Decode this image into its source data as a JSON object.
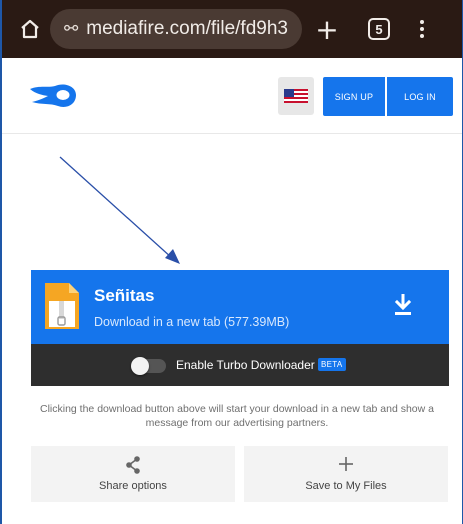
{
  "browser": {
    "url_text": "mediafire.com/file/fd9h3",
    "tab_count": "5",
    "site_settings_glyph": "⚯"
  },
  "header": {
    "signup_label": "SIGN UP",
    "login_label": "LOG IN",
    "flag_icon": "us-flag-icon"
  },
  "file": {
    "name": "Señitas",
    "action_text": "Download in a new tab (577.39MB)"
  },
  "turbo": {
    "label": "Enable Turbo Downloader",
    "badge": "BETA",
    "enabled": false
  },
  "notice": "Clicking the download button above will start your download in a new tab and show a message from our advertising partners.",
  "options": {
    "share_label": "Share options",
    "save_label": "Save to My Files"
  },
  "colors": {
    "brand_blue": "#1575ec",
    "browser_bar": "#2a1a14",
    "turbo_bar": "#2e2e2e",
    "annotation_arrow": "#2a4fa8"
  }
}
